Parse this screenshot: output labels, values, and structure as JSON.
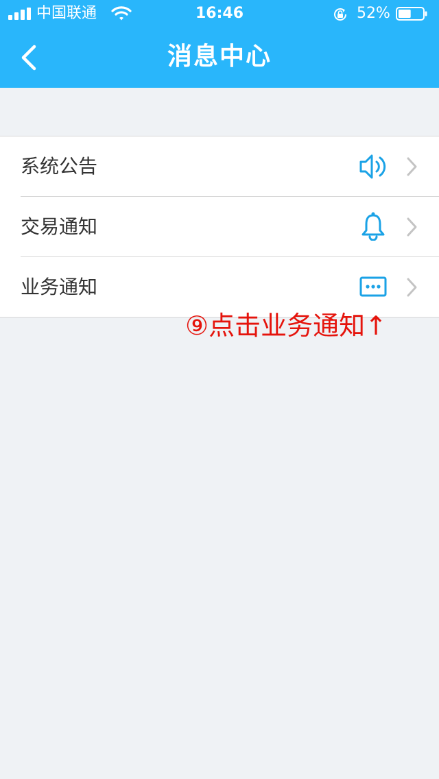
{
  "status_bar": {
    "carrier": "中国联通",
    "time": "16:46",
    "battery_percent": "52%",
    "battery_level": 0.52
  },
  "header": {
    "title": "消息中心"
  },
  "list": {
    "items": [
      {
        "label": "系统公告",
        "icon": "speaker-icon"
      },
      {
        "label": "交易通知",
        "icon": "bell-icon"
      },
      {
        "label": "业务通知",
        "icon": "message-dots-icon"
      }
    ]
  },
  "annotation": {
    "text": "⑨点击业务通知↑"
  },
  "colors": {
    "header_bg": "#29b6fb",
    "icon_blue": "#1aa2e6",
    "annotation_red": "#e5140c",
    "page_bg": "#eff2f5"
  }
}
